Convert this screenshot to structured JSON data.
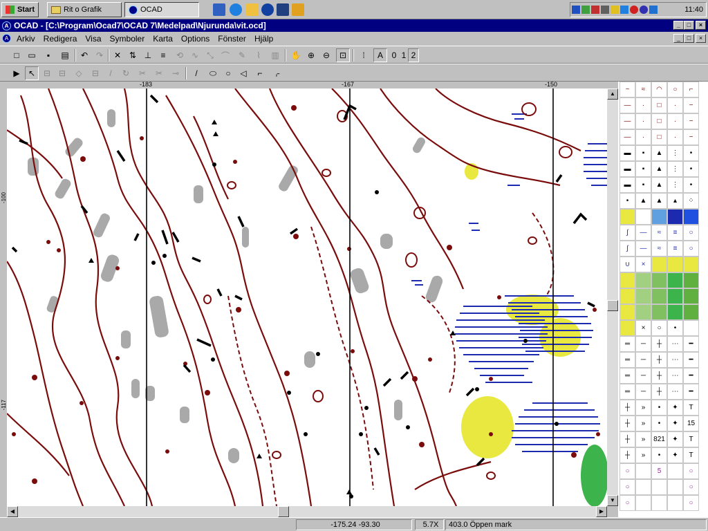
{
  "taskbar": {
    "start_label": "Start",
    "tasks": [
      {
        "label": "Rit o Grafik"
      },
      {
        "label": "OCAD"
      }
    ],
    "clock": "11:40"
  },
  "window": {
    "app_name": "OCAD",
    "title": "OCAD  - [C:\\Program\\Ocad7\\OCAD 7\\Medelpad\\Njurunda\\vit.ocd]"
  },
  "menu": [
    "Arkiv",
    "Redigera",
    "Visa",
    "Symboler",
    "Karta",
    "Options",
    "Fönster",
    "Hjälp"
  ],
  "toolbar": {
    "layer_labels": [
      "0",
      "1",
      "2"
    ]
  },
  "ruler": {
    "top_labels": [
      "-183",
      "-167",
      "-150"
    ],
    "left_labels": [
      "-100",
      "-117"
    ]
  },
  "palette": {
    "number_labels": [
      "5",
      "821",
      "15"
    ]
  },
  "status": {
    "coords": "-175.24   -93.30",
    "zoom": "5.7X",
    "symbol": "403.0 Öppen mark"
  },
  "colors": {
    "contour": "#7a0c0c",
    "rock_gray": "#a9a9a9",
    "water_blue": "#1c2ab0",
    "marsh_yellow": "#e8e840",
    "title_blue": "#000080",
    "green": "#3cb44b"
  }
}
